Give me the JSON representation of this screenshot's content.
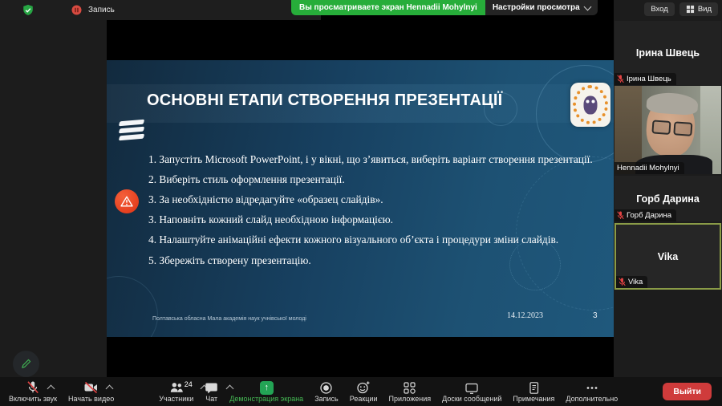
{
  "top_bar": {
    "recording_label": "Запись",
    "banner_text": "Вы просматриваете экран Hennadii Mohylnyi",
    "view_settings_label": "Настройки просмотра",
    "login_label": "Вход",
    "view_label": "Вид"
  },
  "slide": {
    "title": "ОСНОВНІ ЕТАПИ СТВОРЕННЯ ПРЕЗЕНТАЦІЇ",
    "items": [
      "1. Запустіть Microsoft PowerPoint, і у вікні, що з’явиться, виберіть варіант створення презентації.",
      "2. Виберіть стиль оформлення презентації.",
      "3. За необхідністю відредагуйте «образец слайдів».",
      "3. Наповніть кожний слайд необхідною інформацією.",
      "4. Налаштуйте анімаційні ефекти кожного візуального об’єкта і процедури зміни слайдів.",
      "5. Збережіть створену презентацію."
    ],
    "footer_org": "Полтавська обласна Мала академія наук учнівської молоді",
    "footer_date": "14.12.2023",
    "page_number": "3"
  },
  "sidebar": {
    "participants": [
      {
        "name": "Ірина Швець",
        "muted": true,
        "video": false,
        "active_speaker": false
      },
      {
        "name": "Hennadii Mohylnyi",
        "muted": false,
        "video": true,
        "active_speaker": false
      },
      {
        "name": "Горб Дарина",
        "muted": true,
        "video": false,
        "active_speaker": false
      },
      {
        "name": "Vika",
        "muted": true,
        "video": false,
        "active_speaker": true
      }
    ]
  },
  "toolbar": {
    "items": [
      {
        "label": "Включить звук",
        "icon": "mic-muted",
        "chevron": true
      },
      {
        "label": "Начать видео",
        "icon": "camera-muted",
        "chevron": true
      },
      {
        "label": "Участники",
        "icon": "participants",
        "badge": "24",
        "chevron": true
      },
      {
        "label": "Чат",
        "icon": "chat",
        "chevron": true
      },
      {
        "label": "Демонстрация экрана",
        "icon": "screen-share",
        "active": true
      },
      {
        "label": "Запись",
        "icon": "record"
      },
      {
        "label": "Реакции",
        "icon": "reactions"
      },
      {
        "label": "Приложения",
        "icon": "apps"
      },
      {
        "label": "Доски сообщений",
        "icon": "whiteboards"
      },
      {
        "label": "Примечания",
        "icon": "notes"
      },
      {
        "label": "Дополнительно",
        "icon": "more"
      }
    ],
    "leave_label": "Выйти",
    "share_arrow_glyph": "↑"
  },
  "colors": {
    "banner_green": "#27ad3a",
    "share_active_green": "#45b954",
    "leave_red": "#cf3b3b",
    "muted_red": "#e24343",
    "active_speaker_border": "#8a9b47",
    "slide_bg_left": "#122a3e",
    "slide_bg_right": "#1f587c"
  }
}
